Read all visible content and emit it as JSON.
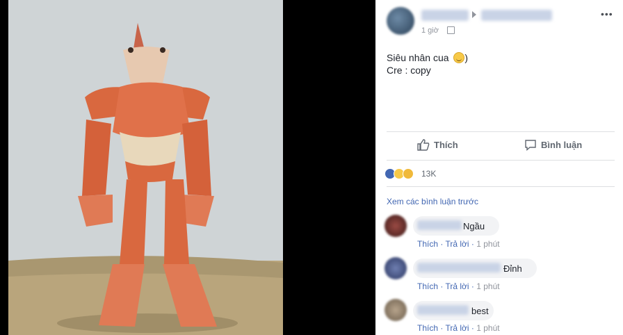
{
  "post": {
    "time": "1 giờ",
    "line1": "Siêu nhân cua",
    "line1_suffix": ")",
    "line2": "Cre : copy",
    "more": "•••"
  },
  "actions": {
    "like": "Thích",
    "comment": "Bình luận"
  },
  "reactions": {
    "count": "13K"
  },
  "comments": {
    "view_previous": "Xem các bình luận trước",
    "items": [
      {
        "text": "Ngầu",
        "like": "Thích",
        "reply": "Trả lời",
        "time": "1 phút"
      },
      {
        "text": "Đỉnh",
        "like": "Thích",
        "reply": "Trả lời",
        "time": "1 phút"
      },
      {
        "text": "best",
        "like": "Thích",
        "reply": "Trả lời",
        "time": "1 phút"
      }
    ]
  },
  "colors": {
    "link": "#4267b2",
    "meta": "#90949c",
    "crab": "#d9683f"
  }
}
